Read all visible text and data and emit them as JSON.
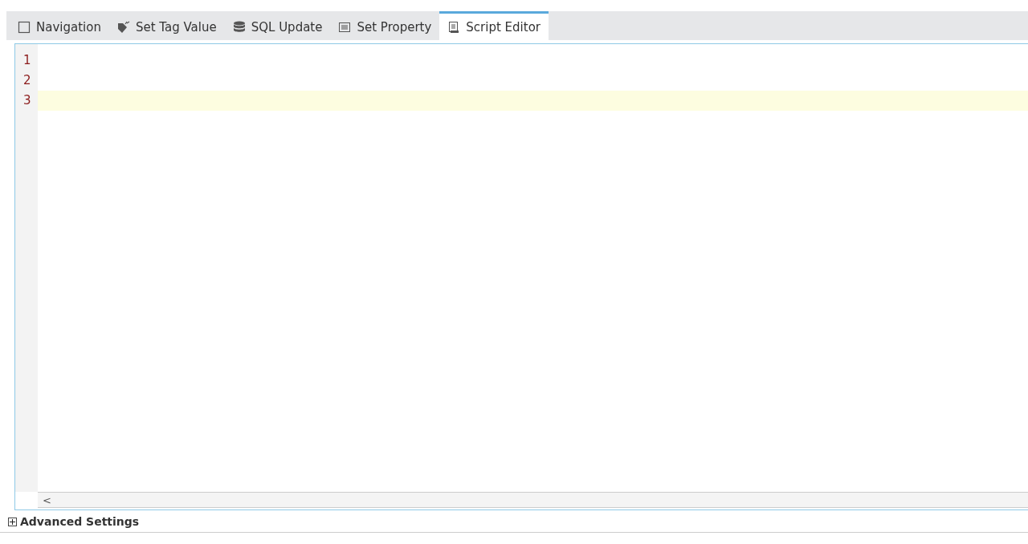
{
  "tabs": [
    {
      "label": "Navigation",
      "kind": "navigation",
      "selected": false
    },
    {
      "label": "Set Tag Value",
      "kind": "tag",
      "selected": false
    },
    {
      "label": "SQL Update",
      "kind": "database",
      "selected": false
    },
    {
      "label": "Set Property",
      "kind": "property",
      "selected": false
    },
    {
      "label": "Script Editor",
      "kind": "script",
      "selected": true
    }
  ],
  "editor": {
    "lines": [
      {
        "number": "1",
        "current": false
      },
      {
        "number": "2",
        "current": false
      },
      {
        "number": "3",
        "current": true
      }
    ],
    "scroll_left": "<"
  },
  "advanced_settings": {
    "label": "Advanced Settings",
    "expanded": false
  }
}
